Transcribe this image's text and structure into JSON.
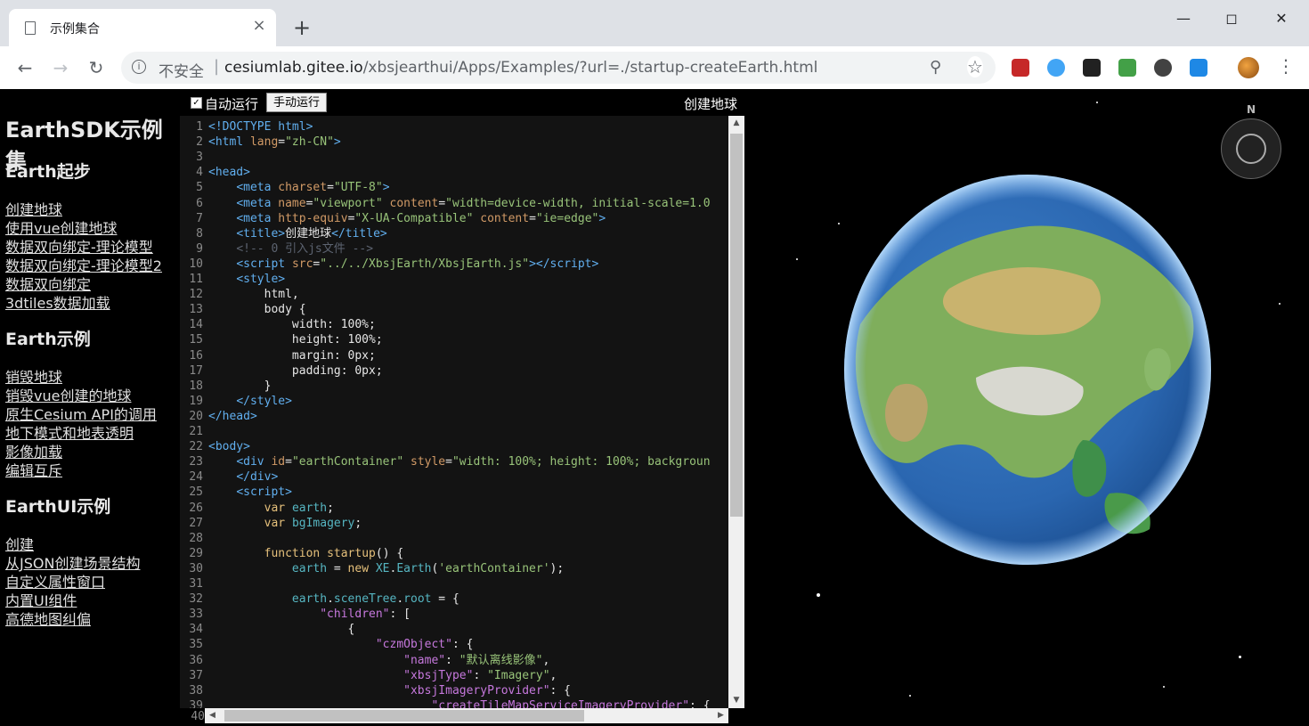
{
  "browser": {
    "tab_title": "示例集合",
    "tab_close": "×",
    "new_tab": "+",
    "insecure_label": "不安全",
    "url_host": "cesiumlab.gitee.io",
    "url_path": "/xbsjearthui/Apps/Examples/?url=./startup-createEarth.html",
    "icons": [
      "back-arrow-icon",
      "forward-arrow-icon",
      "reload-icon",
      "info-icon",
      "zoom-icon",
      "bookmark-star-icon",
      "menu-dots-icon"
    ]
  },
  "sidebar": {
    "brand": "EarthSDK示例集",
    "sections": [
      {
        "title": "Earth起步",
        "items": [
          "创建地球",
          "使用vue创建地球",
          "数据双向绑定-理论模型",
          "数据双向绑定-理论模型2",
          "数据双向绑定",
          "3dtiles数据加载"
        ]
      },
      {
        "title": "Earth示例",
        "items": [
          "销毁地球",
          "销毁vue创建的地球",
          "原生Cesium API的调用",
          "地下模式和地表透明",
          "影像加载",
          "编辑互斥"
        ]
      },
      {
        "title": "EarthUI示例",
        "items": [
          "创建",
          "从JSON创建场景结构",
          "自定义属性窗口",
          "内置UI组件",
          "高德地图纠偏"
        ]
      }
    ]
  },
  "editor": {
    "auto_run_label": "自动运行",
    "auto_run_checked": true,
    "manual_run_label": "手动运行",
    "page_title": "创建地球",
    "last_line_number": "40"
  },
  "viewer": {
    "compass_label": "N"
  },
  "colors": {
    "editor_bg": "#131313",
    "keyword": "#e5c07b",
    "string": "#98c379",
    "tag": "#61afef"
  }
}
